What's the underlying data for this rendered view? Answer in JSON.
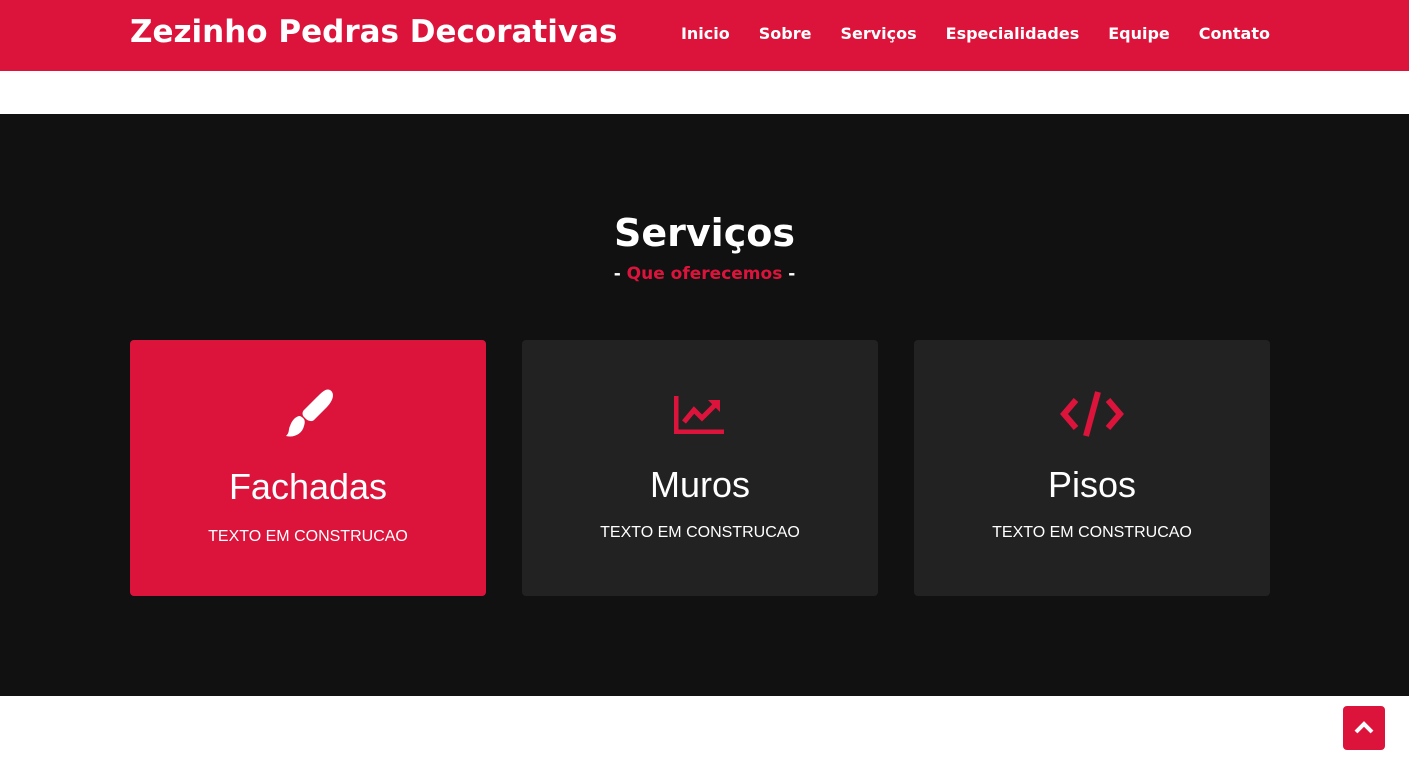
{
  "navbar": {
    "brand": "Zezinho Pedras Decorativas",
    "links": [
      "Inicio",
      "Sobre",
      "Serviços",
      "Especialidades",
      "Equipe",
      "Contato"
    ]
  },
  "services": {
    "title": "Serviços",
    "subtitle_dash_left": "-",
    "subtitle": "Que oferecemos",
    "subtitle_dash_right": "-",
    "cards": [
      {
        "icon": "paint-brush-icon",
        "title": "Fachadas",
        "text": "TEXTO EM CONSTRUCAO"
      },
      {
        "icon": "chart-line-icon",
        "title": "Muros",
        "text": "TEXTO EM CONSTRUCAO"
      },
      {
        "icon": "code-icon",
        "title": "Pisos",
        "text": "TEXTO EM CONSTRUCAO"
      }
    ]
  },
  "back_to_top": {
    "icon": "chevron-up-icon"
  },
  "colors": {
    "accent": "#dc143c",
    "dark_bg": "#111111",
    "card_bg": "#222222"
  }
}
